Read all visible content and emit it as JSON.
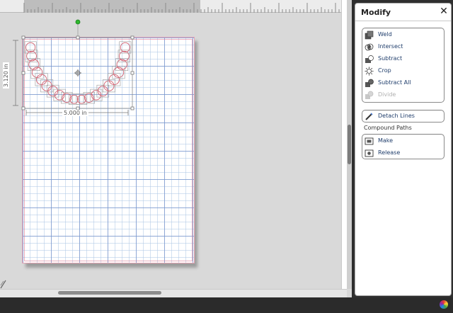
{
  "panel": {
    "title": "Modify",
    "close_icon": "close-icon",
    "modify_buttons": [
      {
        "label": "Weld",
        "icon": "weld-icon",
        "enabled": true
      },
      {
        "label": "Intersect",
        "icon": "intersect-icon",
        "enabled": true
      },
      {
        "label": "Subtract",
        "icon": "subtract-icon",
        "enabled": true
      },
      {
        "label": "Crop",
        "icon": "crop-icon",
        "enabled": true
      },
      {
        "label": "Subtract All",
        "icon": "subtract-all-icon",
        "enabled": true
      },
      {
        "label": "Divide",
        "icon": "divide-icon",
        "enabled": false
      }
    ],
    "detach": {
      "label": "Detach Lines",
      "icon": "detach-lines-icon"
    },
    "compound": {
      "title": "Compound Paths",
      "buttons": [
        {
          "label": "Make",
          "icon": "make-compound-icon"
        },
        {
          "label": "Release",
          "icon": "release-compound-icon"
        }
      ]
    }
  },
  "canvas": {
    "width_label": "5.000 in",
    "height_label": "3.120 in"
  },
  "colors": {
    "accent_text": "#1f3d6b",
    "mat_line": "#7896cd",
    "shape_stroke": "#d0606f",
    "rotate_handle": "#2eb82e"
  }
}
